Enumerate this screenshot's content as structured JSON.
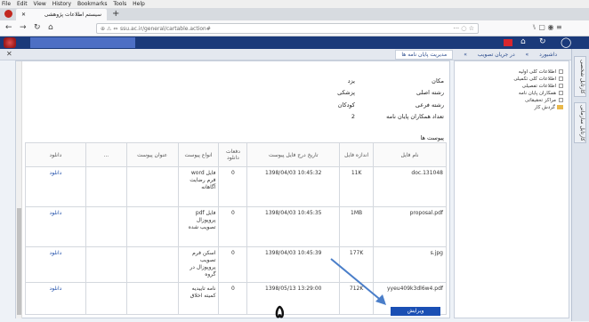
{
  "browser": {
    "menu": [
      "File",
      "Edit",
      "View",
      "History",
      "Bookmarks",
      "Tools",
      "Help"
    ],
    "tab_title": "سیستم اطلاعات پژوهشی",
    "tab_close": "✕",
    "tab_new": "+",
    "url": "ssu.ac.ir/general/cartable.action#",
    "url_prefix": "⊕ ⚠ ⇔",
    "url_right": "··· ◌ ☆",
    "toolbar_right": "⑊ ▢ ◉ ≡"
  },
  "subbar": {
    "close": "✕",
    "breadcrumbs": [
      "داشبورد",
      "»",
      "در جریان تصویب",
      "»",
      "مدیریت پایان نامه ها"
    ]
  },
  "vertical_tabs": [
    "کارتابل شخصی",
    "کارتابل سازمانی"
  ],
  "tree": [
    {
      "label": "اطلاعات کلی اولیه",
      "type": "checkbox"
    },
    {
      "label": "اطلاعات کلی تکمیلی",
      "type": "checkbox"
    },
    {
      "label": "اطلاعات تفصیلی",
      "type": "checkbox"
    },
    {
      "label": "همکاران پایان نامه",
      "type": "checkbox"
    },
    {
      "label": "مراکز تحقیقاتی",
      "type": "checkbox"
    },
    {
      "label": "گردش کار",
      "type": "folder"
    }
  ],
  "info": [
    {
      "label": "مکان",
      "value": "یزد"
    },
    {
      "label": "رشته اصلی",
      "value": "پزشکی"
    },
    {
      "label": "رشته فرعی",
      "value": "کودکان"
    },
    {
      "label": "تعداد همکاران پایان نامه",
      "value": "2"
    }
  ],
  "attachments": {
    "title": "پیوست ها",
    "headers": [
      "نام فایل",
      "اندازه فایل",
      "تاریخ درج فایل پیوست",
      "دفعات دانلود",
      "انواع پیوست",
      "عنوان پیوست",
      "...",
      "دانلود"
    ],
    "rows": [
      {
        "name": "doc.131048",
        "size": "11K",
        "date": "10:45:32  1398/04/03",
        "downloads": "0",
        "kind": "فایل word فرم رضایت آگاهانه",
        "title": "",
        "extra": "",
        "download": "دانلود"
      },
      {
        "name": "proposal.pdf",
        "size": "1MB",
        "date": "10:45:35  1398/04/03",
        "downloads": "0",
        "kind": "فایل pdf پروپوزال تصویب شده",
        "title": "",
        "extra": "",
        "download": "دانلود"
      },
      {
        "name": "s.jpg",
        "size": "177K",
        "date": "10:45:39  1398/04/03",
        "downloads": "0",
        "kind": "اسکن فرم تصویب پروپوزال در گروه",
        "title": "",
        "extra": "",
        "download": "دانلود"
      },
      {
        "name": "yyeu409k3dl6w4.pdf",
        "size": "712K",
        "date": "13:29:00  1398/05/13",
        "downloads": "0",
        "kind": "نامه تاییدیه کمیته اخلاق",
        "title": "",
        "extra": "",
        "download": "دانلود"
      }
    ]
  },
  "edit_button": "ویرایش",
  "annotation_number": "۵",
  "colors": {
    "app_bar": "#1b3a7a",
    "button": "#1a4fb4",
    "arrow": "#4a7ec9"
  }
}
